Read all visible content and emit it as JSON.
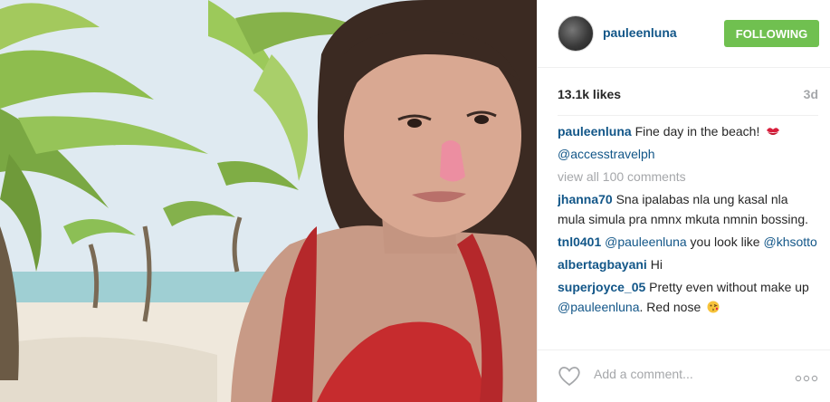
{
  "post": {
    "username": "pauleenluna",
    "follow_label": "FOLLOWING",
    "likes": "13.1k likes",
    "time_ago": "3d"
  },
  "caption": {
    "user": "pauleenluna",
    "text": " Fine day in the beach!",
    "emoji": "kiss-mark-icon",
    "mention": "@accesstravelph"
  },
  "view_all": "view all 100 comments",
  "comments": [
    {
      "user": "jhanna70",
      "text": " Sna ipalabas nla ung kasal nla mula simula pra nmnx mkuta nmnin bossing."
    },
    {
      "user": "tnl0401",
      "mention": " @pauleenluna",
      "text": " you look like ",
      "mention2": "@khsotto"
    },
    {
      "user": "albertagbayani",
      "text": " Hi"
    },
    {
      "user": "superjoyce_05",
      "text": " Pretty even without make up ",
      "mention": "@pauleenluna",
      "text2": ". Red nose"
    }
  ],
  "footer": {
    "add_comment_placeholder": "Add a comment...",
    "like_icon": "heart-icon",
    "more_icon": "more-options-icon"
  },
  "colors": {
    "link_blue": "#125688",
    "follow_green": "#70c050",
    "muted_gray": "#a5a7aa"
  }
}
